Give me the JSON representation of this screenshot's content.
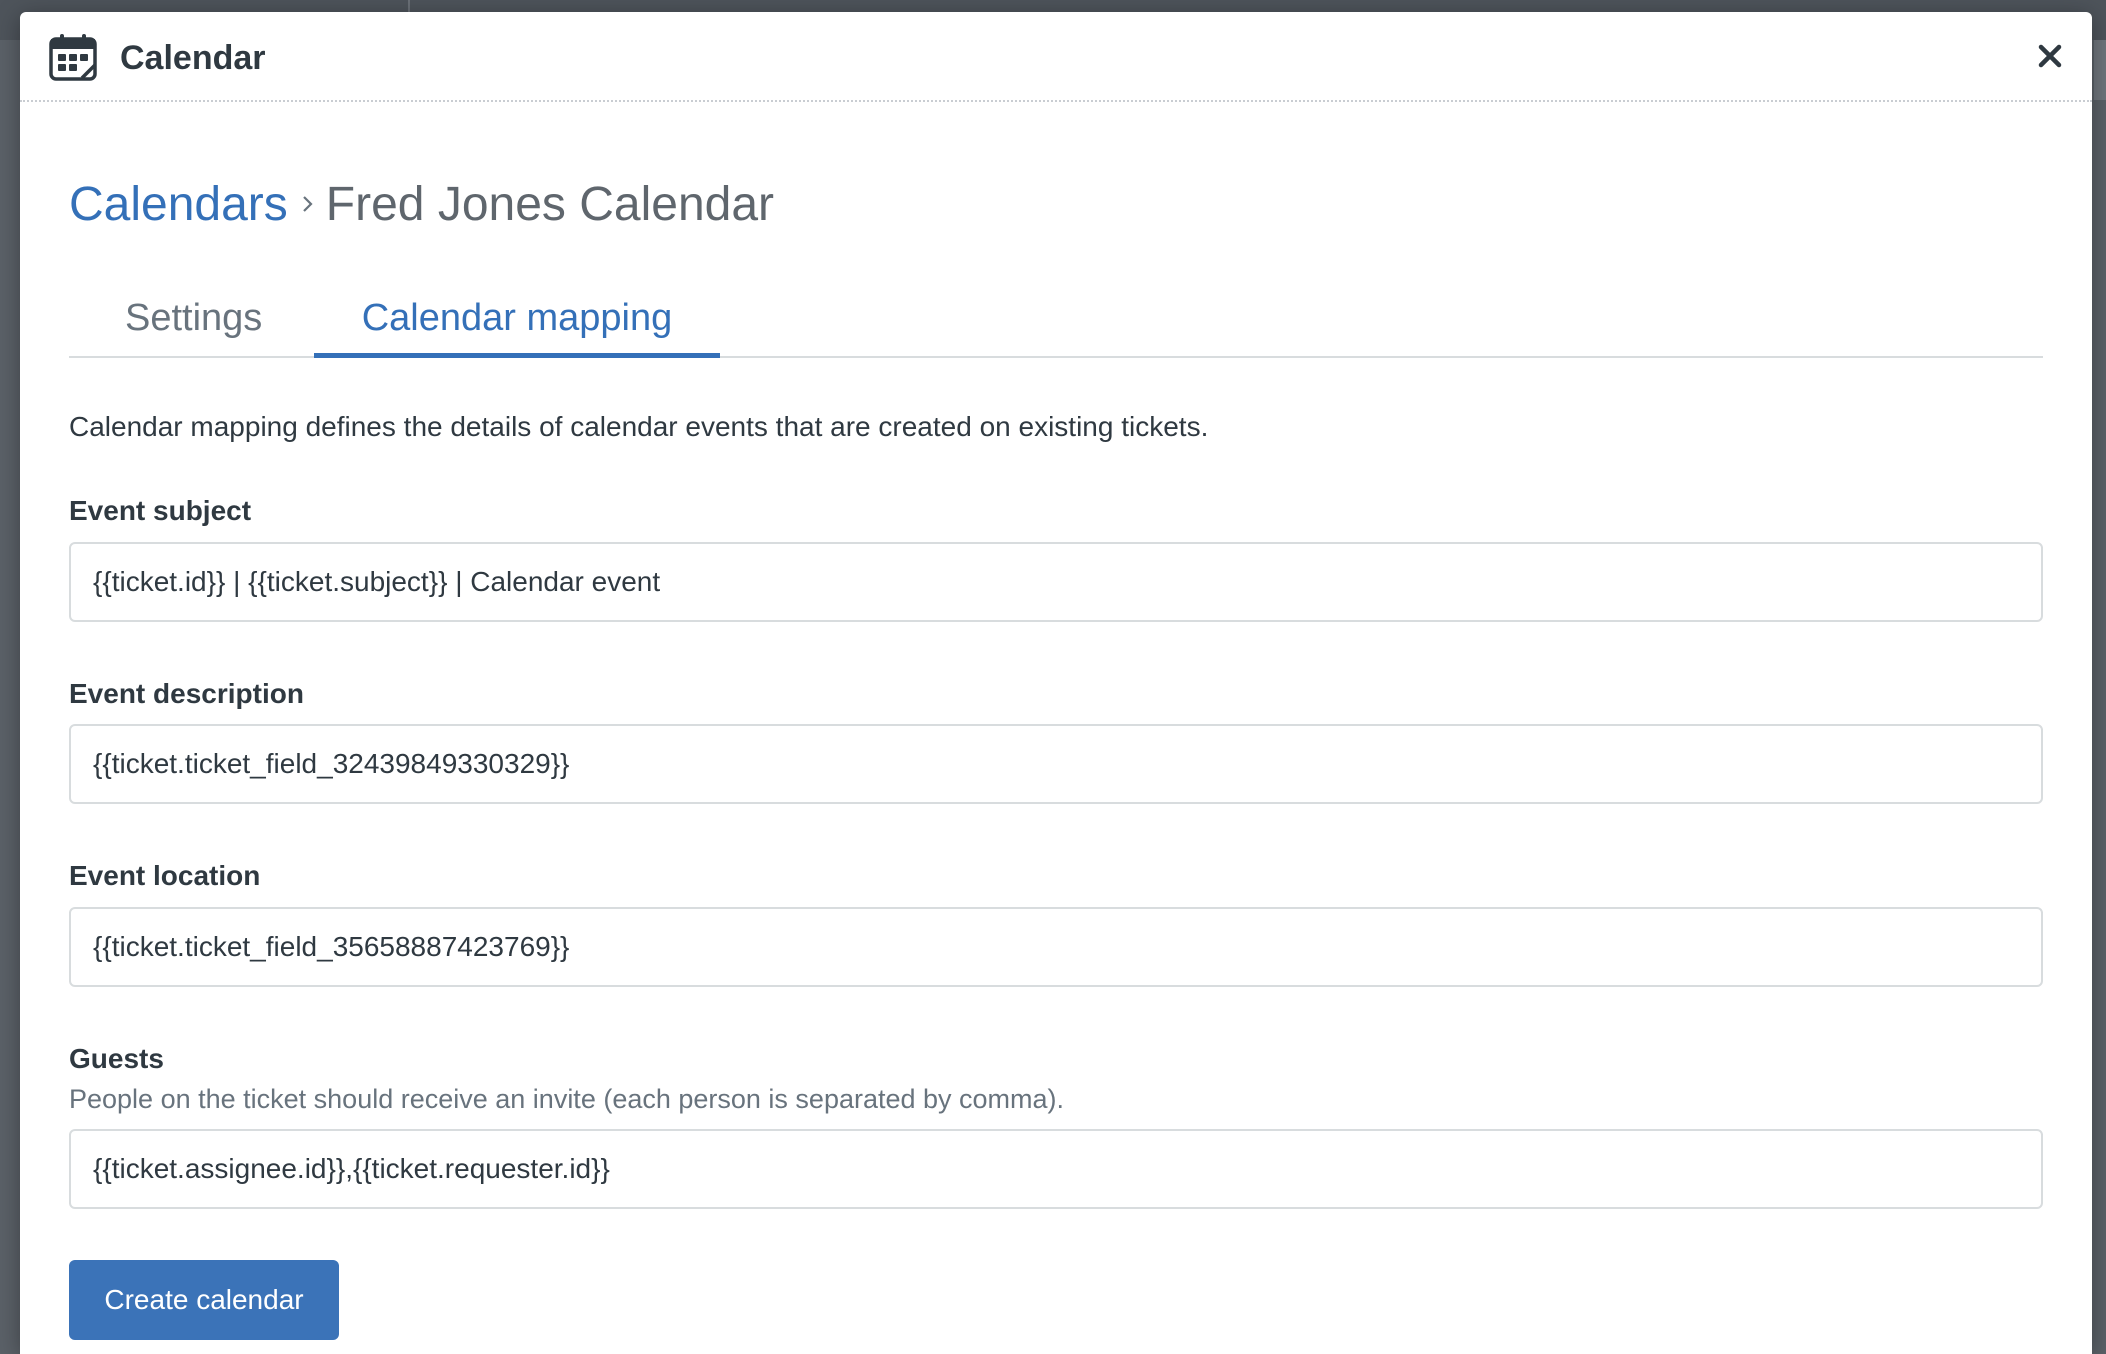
{
  "modal": {
    "title": "Calendar",
    "icon": "calendar-icon",
    "close_icon": "close-icon"
  },
  "breadcrumb": {
    "parent": "Calendars",
    "separator_icon": "chevron-right-icon",
    "current": "Fred Jones Calendar"
  },
  "tabs": [
    {
      "label": "Settings",
      "active": false
    },
    {
      "label": "Calendar mapping",
      "active": true
    }
  ],
  "intro": "Calendar mapping defines the details of calendar events that are created on existing tickets.",
  "fields": {
    "subject": {
      "label": "Event subject",
      "value": "{{ticket.id}} | {{ticket.subject}} | Calendar event"
    },
    "description": {
      "label": "Event description",
      "value": "{{ticket.ticket_field_32439849330329}}"
    },
    "location": {
      "label": "Event location",
      "value": "{{ticket.ticket_field_35658887423769}}"
    },
    "guests": {
      "label": "Guests",
      "hint": "People on the ticket should receive an invite (each person is separated by comma).",
      "value": "{{ticket.assignee.id}},{{ticket.requester.id}}"
    }
  },
  "actions": {
    "create_label": "Create calendar"
  },
  "colors": {
    "accent": "#3470b8",
    "button": "#3b73b8",
    "text": "#2f3941",
    "muted": "#68737d",
    "border": "#d8dcde"
  }
}
